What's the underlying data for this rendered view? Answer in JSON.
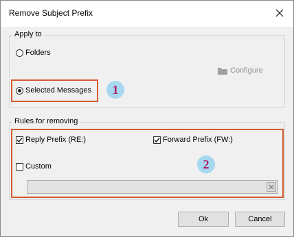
{
  "window": {
    "title": "Remove Subject Prefix"
  },
  "apply_to": {
    "label": "Apply to",
    "folders_label": "Folders",
    "selected_messages_label": "Selected Messages",
    "selected": "Selected Messages",
    "configure_label": "Configure",
    "badge": "1"
  },
  "rules": {
    "label": "Rules for removing",
    "reply_prefix_label": "Reply Prefix (RE:)",
    "reply_prefix_checked": true,
    "forward_prefix_label": "Forward Prefix (FW:)",
    "forward_prefix_checked": true,
    "custom_label": "Custom",
    "custom_checked": false,
    "custom_value": "",
    "badge": "2"
  },
  "buttons": {
    "ok": "Ok",
    "cancel": "Cancel"
  },
  "colors": {
    "highlight_border": "#d35b2e",
    "badge_bg": "#a6d8f0",
    "badge_text": "#b0226a"
  }
}
